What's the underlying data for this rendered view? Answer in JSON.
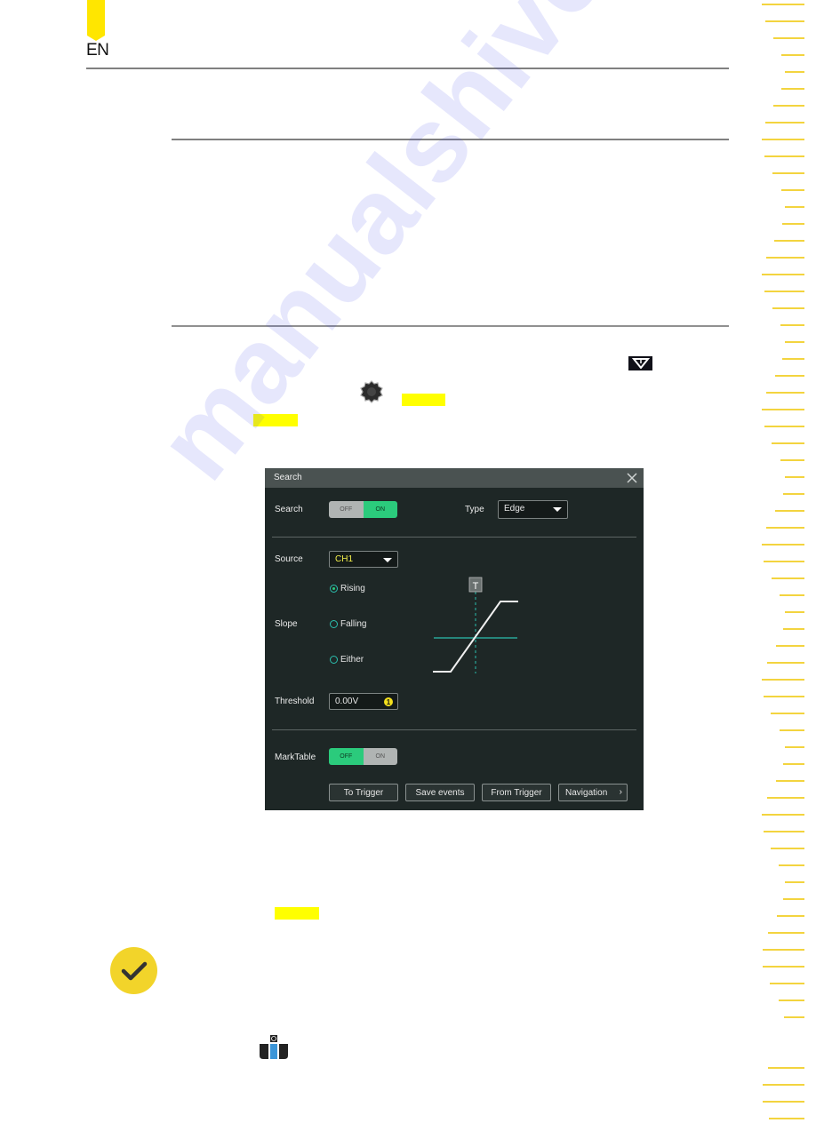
{
  "header": {
    "language": "EN"
  },
  "inline_icons": {
    "menu": "menu-dropdown-icon",
    "gear": "function-navigation-icon"
  },
  "dialog": {
    "title": "Search",
    "close_icon": "close-icon",
    "search": {
      "label": "Search",
      "off": "OFF",
      "on": "ON",
      "state": "ON"
    },
    "type": {
      "label": "Type",
      "value": "Edge"
    },
    "source": {
      "label": "Source",
      "value": "CH1"
    },
    "slope": {
      "label": "Slope",
      "options": [
        {
          "label": "Rising",
          "selected": true
        },
        {
          "label": "Falling",
          "selected": false
        },
        {
          "label": "Either",
          "selected": false
        }
      ]
    },
    "diagram": {
      "trigger_marker": "T"
    },
    "threshold": {
      "label": "Threshold",
      "value": "0.00V",
      "badge": "1"
    },
    "marktable": {
      "label": "MarkTable",
      "off": "OFF",
      "on": "ON",
      "state": "OFF"
    },
    "buttons": [
      {
        "label": "To Trigger"
      },
      {
        "label": "Save events"
      },
      {
        "label": "From Trigger"
      },
      {
        "label": "Navigation",
        "chevron": "›"
      }
    ]
  },
  "colors": {
    "accent_yellow": "#ffe600",
    "highlight": "#ffff00",
    "toggle_on": "#2bcb7c",
    "source_text": "#f3f04a",
    "dialog_bg": "#1e2726",
    "dialog_title_bg": "#4a5251"
  },
  "watermark": "manualshive.com"
}
